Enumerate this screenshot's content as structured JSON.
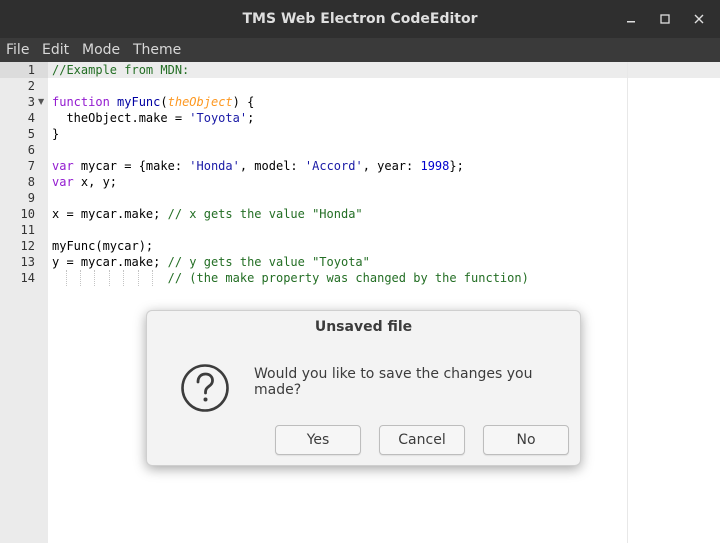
{
  "window": {
    "title": "TMS Web Electron CodeEditor"
  },
  "menu": {
    "items": [
      "File",
      "Edit",
      "Mode",
      "Theme"
    ]
  },
  "editor": {
    "line_numbers": [
      "1",
      "2",
      "3",
      "4",
      "5",
      "6",
      "7",
      "8",
      "9",
      "10",
      "11",
      "12",
      "13",
      "14"
    ],
    "lines": [
      [
        {
          "t": "//Example from MDN:",
          "c": "comment"
        }
      ],
      [],
      [
        {
          "t": "function",
          "c": "kw"
        },
        {
          "t": " ",
          "c": ""
        },
        {
          "t": "myFunc",
          "c": "fn"
        },
        {
          "t": "(",
          "c": ""
        },
        {
          "t": "theObject",
          "c": "param"
        },
        {
          "t": ") {",
          "c": ""
        }
      ],
      [
        {
          "t": "  theObject.make = ",
          "c": ""
        },
        {
          "t": "'Toyota'",
          "c": "string"
        },
        {
          "t": ";",
          "c": ""
        }
      ],
      [
        {
          "t": "}",
          "c": ""
        }
      ],
      [],
      [
        {
          "t": "var",
          "c": "kw"
        },
        {
          "t": " mycar = {make: ",
          "c": ""
        },
        {
          "t": "'Honda'",
          "c": "string"
        },
        {
          "t": ", model: ",
          "c": ""
        },
        {
          "t": "'Accord'",
          "c": "string"
        },
        {
          "t": ", year: ",
          "c": ""
        },
        {
          "t": "1998",
          "c": "number"
        },
        {
          "t": "};",
          "c": ""
        }
      ],
      [
        {
          "t": "var",
          "c": "kw"
        },
        {
          "t": " x, y;",
          "c": ""
        }
      ],
      [],
      [
        {
          "t": "x = mycar.make; ",
          "c": ""
        },
        {
          "t": "// x gets the value \"Honda\"",
          "c": "comment"
        }
      ],
      [],
      [
        {
          "t": "myFunc(mycar);",
          "c": ""
        }
      ],
      [
        {
          "t": "y = mycar.make; ",
          "c": ""
        },
        {
          "t": "// y gets the value \"Toyota\"",
          "c": "comment"
        }
      ],
      [
        {
          "t": "                ",
          "c": ""
        },
        {
          "t": "// (the make property was changed by the function)",
          "c": "comment"
        }
      ]
    ]
  },
  "dialog": {
    "title": "Unsaved file",
    "message": "Would you like to save the changes you made?",
    "icon": "question-icon",
    "buttons": {
      "yes": "Yes",
      "cancel": "Cancel",
      "no": "No"
    }
  }
}
